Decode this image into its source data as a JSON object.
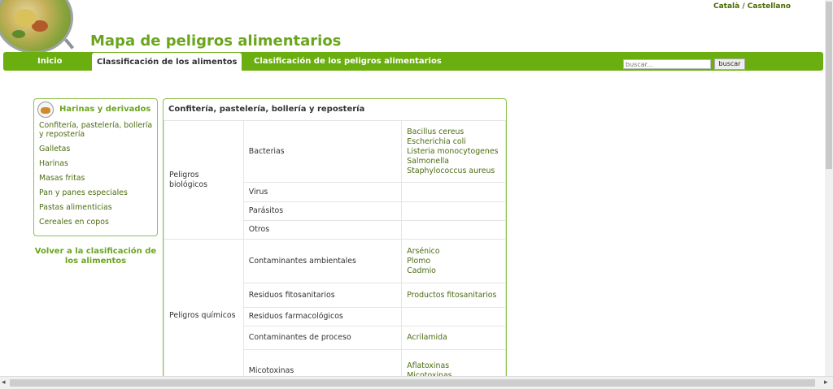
{
  "lang": {
    "catala": "Català",
    "sep": " / ",
    "castellano": "Castellano"
  },
  "site": {
    "title": "Mapa de peligros alimentarios"
  },
  "nav": {
    "items": [
      {
        "label": "Inicio"
      },
      {
        "label": "Classificación de los alimentos"
      },
      {
        "label": "Clasificación de los peligros alimentarios"
      }
    ],
    "search_placeholder": "buscar...",
    "search_button": "buscar"
  },
  "sidebar": {
    "title": "Harinas y derivados",
    "items": [
      {
        "label": "Confitería, pastelería, bollería y repostería"
      },
      {
        "label": "Galletas"
      },
      {
        "label": "Harinas"
      },
      {
        "label": "Masas fritas"
      },
      {
        "label": "Pan y panes especiales"
      },
      {
        "label": "Pastas alimenticias"
      },
      {
        "label": "Cereales en copos"
      }
    ],
    "back_link": "Volver a la clasificación de los alimentos"
  },
  "content": {
    "title": "Confitería, pastelería, bollería y repostería",
    "groups": [
      {
        "name": "Peligros biológicos",
        "rows": [
          {
            "category": "Bacterias",
            "agents": [
              "Bacillus cereus",
              "Escherichia coli",
              "Listeria monocytogenes",
              "Salmonella",
              "Staphylococcus aureus"
            ]
          },
          {
            "category": "Virus",
            "agents": []
          },
          {
            "category": "Parásitos",
            "agents": []
          },
          {
            "category": "Otros",
            "agents": []
          }
        ]
      },
      {
        "name": "Peligros químicos",
        "rows": [
          {
            "category": "Contaminantes ambientales",
            "agents": [
              "Arsénico",
              "Plomo",
              "Cadmio"
            ]
          },
          {
            "category": "Residuos fitosanitarios",
            "agents": [
              "Productos fitosanitarios"
            ]
          },
          {
            "category": "Residuos farmacológicos",
            "agents": []
          },
          {
            "category": "Contaminantes de proceso",
            "agents": [
              "Acrilamida"
            ]
          },
          {
            "category": "Micotoxinas",
            "agents": [
              "Aflatoxinas",
              "Micotoxinas"
            ]
          }
        ]
      }
    ]
  },
  "icons": {
    "logo": "magnifier-food-logo",
    "sidebar": "bread-icon",
    "scroll_left": "◂",
    "scroll_right": "▸"
  },
  "colors": {
    "brand_green": "#6aae0f",
    "title_green": "#6aa51d",
    "link_green": "#4b6c12"
  }
}
